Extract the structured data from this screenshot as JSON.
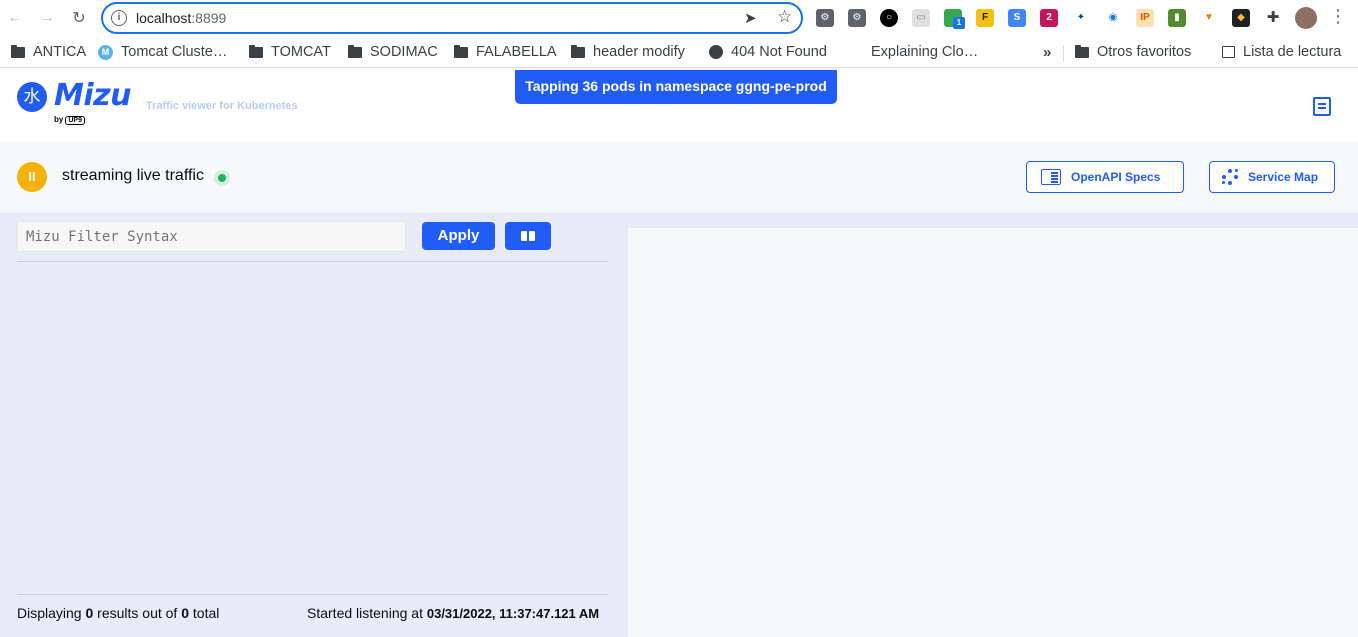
{
  "browser": {
    "url_host": "localhost",
    "url_port": ":8899",
    "bookmarks": [
      {
        "label": "ANTICA",
        "icon": "folder-icon"
      },
      {
        "label": "Tomcat Cluste…",
        "icon": "mizu-tile-icon"
      },
      {
        "label": "TOMCAT",
        "icon": "folder-icon"
      },
      {
        "label": "SODIMAC",
        "icon": "folder-icon"
      },
      {
        "label": "FALABELLA",
        "icon": "folder-icon"
      },
      {
        "label": "header modify",
        "icon": "folder-icon"
      },
      {
        "label": "404 Not Found",
        "icon": "globe-icon"
      },
      {
        "label": "Explaining Clo…",
        "icon": "microsoft-icon"
      }
    ],
    "overflow_label": "»",
    "other_favorites": "Otros favoritos",
    "reading_list": "Lista de lectura",
    "extension_badge": "1"
  },
  "app": {
    "logo_glyph": "水",
    "logo_text": "Mizu",
    "by_text": "by",
    "by_brand": "UP9",
    "tagline": "Traffic viewer for Kubernetes",
    "tapping_banner": "Tapping 36 pods in namespace ggng-pe-prod",
    "status_text": "streaming live traffic",
    "pause_glyph": "II",
    "openapi_button": "OpenAPI Specs",
    "service_map_button": "Service Map",
    "filter_placeholder": "Mizu Filter Syntax",
    "apply_button": "Apply",
    "footer": {
      "displaying_prefix": "Displaying ",
      "displaying_count": "0",
      "results_mid": " results out of ",
      "total_count": "0",
      "total_suffix": " total",
      "started_prefix": "Started listening at ",
      "started_timestamp": "03/31/2022, 11:37:47.121 AM"
    }
  },
  "colors": {
    "brand": "#205cf5",
    "pause": "#f6b10a",
    "live": "#27ae60",
    "main_bg": "#e9ebf8",
    "panel_bg": "#f7f9fc"
  }
}
